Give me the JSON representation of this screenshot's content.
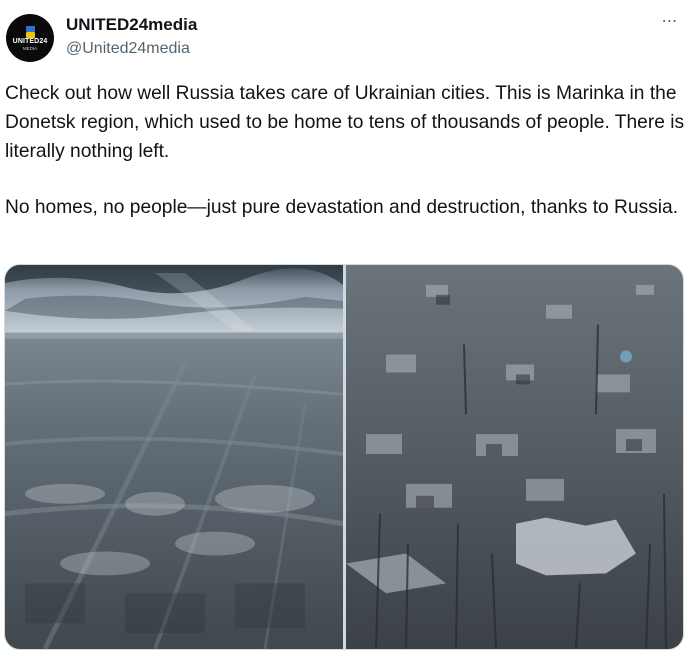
{
  "account": {
    "display_name": "UNITED24media",
    "handle": "@United24media",
    "avatar_text": "UNITED24",
    "avatar_subtext": "MEDIA",
    "brand_colors": {
      "flag_blue": "#2f6fd6",
      "flag_yellow": "#f2c500"
    }
  },
  "menu": {
    "more_icon": "⋯"
  },
  "tweet": {
    "paragraphs": [
      "Check out how well Russia takes care of Ukrainian cities. This is Marinka in the Donetsk region, which used to be home to tens of thousands of people. There is literally nothing left.",
      "No homes, no people—just pure devastation and destruction, thanks to Russia."
    ]
  },
  "media": {
    "photos": [
      {
        "icon": "photo-aerial-wide"
      },
      {
        "icon": "photo-ruins-closeup"
      }
    ]
  }
}
